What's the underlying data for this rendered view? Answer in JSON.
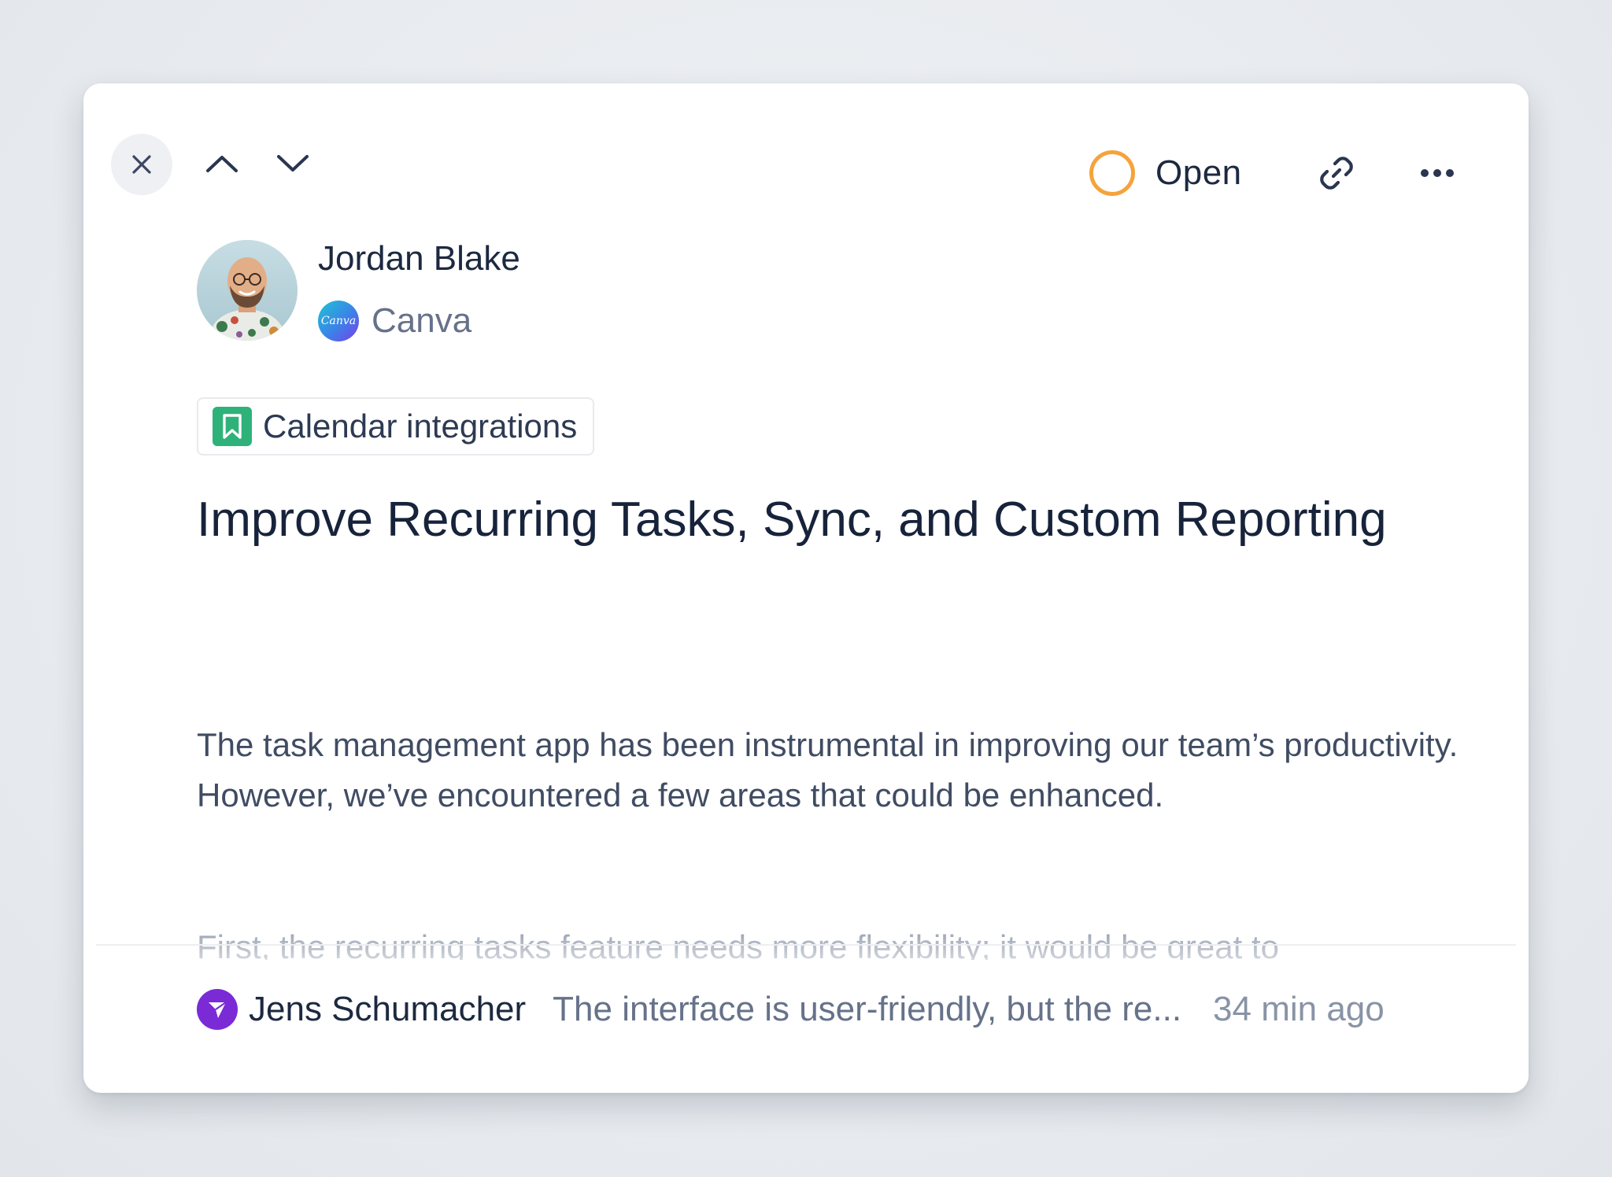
{
  "status": {
    "label": "Open",
    "color": "#f5a33b"
  },
  "toolbar": {
    "icons": [
      "close-icon",
      "chevron-up-icon",
      "chevron-down-icon",
      "link-icon",
      "more-horizontal-icon"
    ]
  },
  "author": {
    "name": "Jordan Blake",
    "company": "Canva",
    "company_logo_text": "Canva"
  },
  "tag": {
    "label": "Calendar integrations",
    "icon": "bookmark-icon",
    "color": "#2fb27a"
  },
  "post": {
    "title": "Improve Recurring Tasks, Sync, and Custom Reporting",
    "body": "The task management app has been instrumental in improving our team’s productivity. However, we’ve encountered a few areas that could be enhanced.",
    "body_continued": "First, the recurring tasks feature needs more flexibility; it would be great to"
  },
  "latest_comment": {
    "author": "Jens Schumacher",
    "preview": "The interface is user-friendly, but the re...",
    "time": "34 min ago",
    "author_logo_color": "#7a2bd6"
  }
}
